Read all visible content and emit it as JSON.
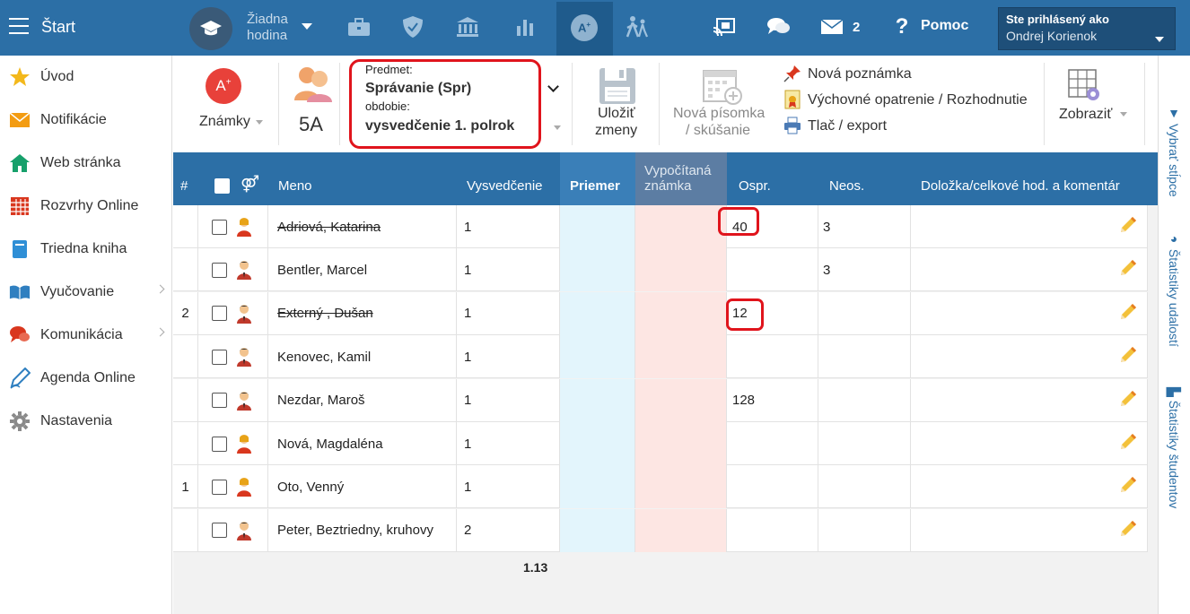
{
  "topbar": {
    "start_label": "Štart",
    "lesson_line1": "Žiadna",
    "lesson_line2": "hodina",
    "messages_count": "2",
    "help_label": "Pomoc",
    "user_line1": "Ste prihlásený ako",
    "user_line2": "Ondrej Korienok"
  },
  "sidebar": {
    "items": [
      {
        "label": "Úvod",
        "icon": "star-icon",
        "color": "#f3b81b"
      },
      {
        "label": "Notifikácie",
        "icon": "envelope-icon",
        "color": "#f39c12"
      },
      {
        "label": "Web stránka",
        "icon": "home-icon",
        "color": "#17a06b"
      },
      {
        "label": "Rozvrhy Online",
        "icon": "calendar-icon",
        "color": "#d9371e"
      },
      {
        "label": "Triedna kniha",
        "icon": "book-icon",
        "color": "#2f8fd6"
      },
      {
        "label": "Vyučovanie",
        "icon": "open-book-icon",
        "color": "#2f7fc0"
      },
      {
        "label": "Komunikácia",
        "icon": "chat-icon",
        "color": "#d9371e"
      },
      {
        "label": "Agenda Online",
        "icon": "pen-icon",
        "color": "#2f7fc0"
      },
      {
        "label": "Nastavenia",
        "icon": "gear-icon",
        "color": "#8a8a8a"
      }
    ]
  },
  "toolbar": {
    "grades_label": "Známky",
    "class_label": "5A",
    "subject_caption": "Predmet:",
    "subject_value": "Správanie (Spr)",
    "period_caption": "obdobie:",
    "period_value": "vysvedčenie 1. polrok",
    "save_line1": "Uložiť",
    "save_line2": "zmeny",
    "new_test_line1": "Nová písomka",
    "new_test_line2": "/ skúšanie",
    "new_note": "Nová poznámka",
    "measure": "Výchovné opatrenie / Rozhodnutie",
    "print": "Tlač / export",
    "show": "Zobraziť"
  },
  "table": {
    "headers": {
      "num": "#",
      "name": "Meno",
      "report": "Vysvedčenie",
      "average": "Priemer",
      "computed_line1": "Vypočítaná",
      "computed_line2": "známka",
      "excused": "Ospr.",
      "unexcused": "Neos.",
      "comment": "Doložka/celkové hod. a komentár"
    },
    "rows": [
      {
        "num": "",
        "name": "Adriová, Katarina",
        "strike": true,
        "gender": "female",
        "report": "1",
        "excused": "40",
        "unexcused": "3"
      },
      {
        "num": "",
        "name": "Bentler, Marcel",
        "strike": false,
        "gender": "male",
        "report": "1",
        "excused": "",
        "unexcused": "3"
      },
      {
        "num": "2",
        "name": "Externý , Dušan",
        "strike": true,
        "gender": "male",
        "report": "1",
        "excused": "12",
        "unexcused": ""
      },
      {
        "num": "",
        "name": "Kenovec, Kamil",
        "strike": false,
        "gender": "male",
        "report": "1",
        "excused": "",
        "unexcused": ""
      },
      {
        "num": "",
        "name": "Nezdar, Maroš",
        "strike": false,
        "gender": "male",
        "report": "1",
        "excused": "128",
        "unexcused": ""
      },
      {
        "num": "",
        "name": "Nová, Magdaléna",
        "strike": false,
        "gender": "female",
        "report": "1",
        "excused": "",
        "unexcused": ""
      },
      {
        "num": "1",
        "name": "Oto, Venný",
        "strike": false,
        "gender": "female",
        "report": "1",
        "excused": "",
        "unexcused": ""
      },
      {
        "num": "",
        "name": "Peter, Beztriedny, kruhovy",
        "strike": false,
        "gender": "male",
        "report": "2",
        "excused": "",
        "unexcused": ""
      }
    ],
    "average_value": "1.13"
  },
  "rightpanel": {
    "select_columns": "Vybrať stĺpce",
    "event_stats": "Štatistiky udalostí",
    "student_stats": "Štatistiky študentov"
  },
  "colors": {
    "primary": "#2c6fa6",
    "highlight": "#e0141c",
    "average_col": "#e3f5fc",
    "computed_col": "#fde6e3"
  }
}
